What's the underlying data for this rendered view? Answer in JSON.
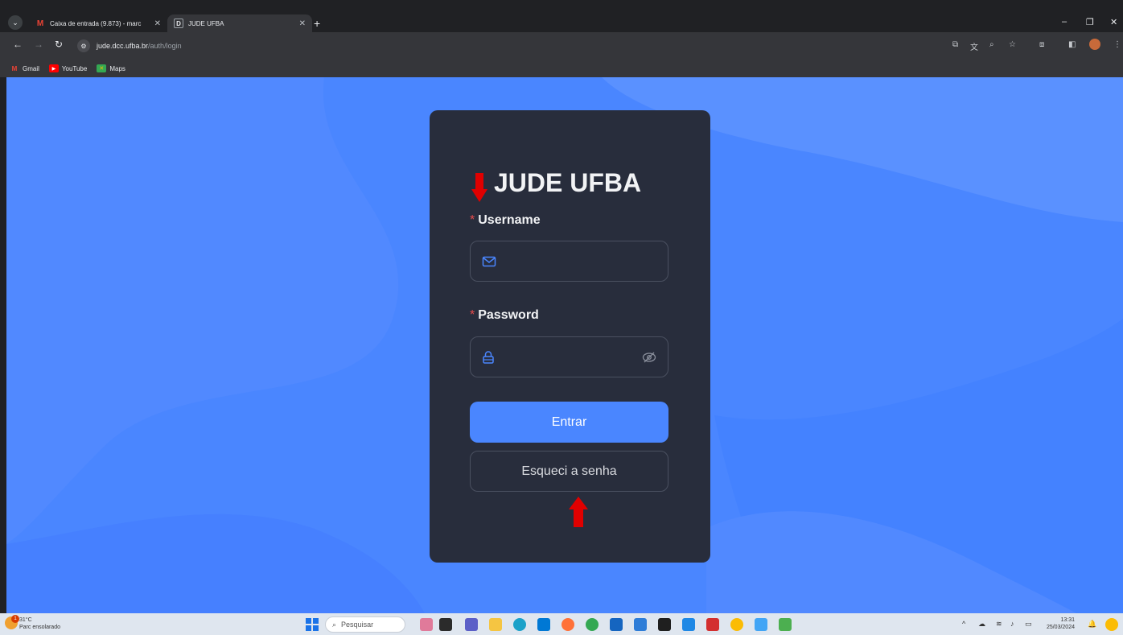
{
  "browser": {
    "tabs": [
      {
        "title": "Caixa de entrada (9.873) - marc",
        "favicon": "gmail-icon",
        "active": false
      },
      {
        "title": "JUDE UFBA",
        "favicon": "D",
        "active": true
      }
    ],
    "url_host": "jude.dcc.ufba.br",
    "url_path": "/auth/login",
    "bookmarks": [
      {
        "label": "Gmail",
        "icon": "gmail-icon"
      },
      {
        "label": "YouTube",
        "icon": "youtube-icon"
      },
      {
        "label": "Maps",
        "icon": "maps-icon"
      }
    ]
  },
  "login": {
    "title": "JUDE UFBA",
    "required_mark": "*",
    "username_label": "Username",
    "username_value": "",
    "password_label": "Password",
    "password_value": "",
    "submit_label": "Entrar",
    "forgot_label": "Esqueci a senha"
  },
  "taskbar": {
    "weather_temp": "31°C",
    "weather_desc": "Parc ensolarado",
    "weather_badge": "1",
    "search_placeholder": "Pesquisar",
    "time": "13:31",
    "date": "25/03/2024"
  },
  "colors": {
    "page_bg": "#4a86ff",
    "card_bg": "#282d3c",
    "accent": "#4a86ff",
    "required": "#e84b4b",
    "annotation_arrow": "#e00000"
  }
}
